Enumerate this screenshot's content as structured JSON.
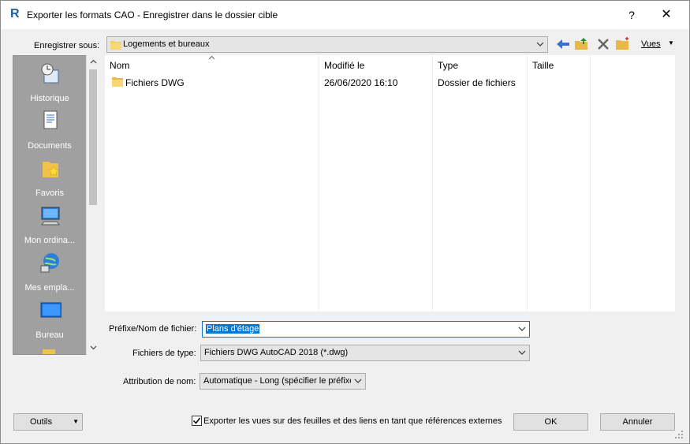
{
  "window": {
    "title": "Exporter les formats CAO - Enregistrer dans le dossier cible",
    "help_label": "?",
    "close_label": "✕"
  },
  "toolbar": {
    "save_in_label": "Enregistrer sous:",
    "current_folder": "Logements et bureaux",
    "views_label": "Vues"
  },
  "places": [
    {
      "label": "Historique",
      "icon": "history-icon"
    },
    {
      "label": "Documents",
      "icon": "documents-icon"
    },
    {
      "label": "Favoris",
      "icon": "favorites-icon"
    },
    {
      "label": "Mon ordina...",
      "icon": "computer-icon"
    },
    {
      "label": "Mes empla...",
      "icon": "network-icon"
    },
    {
      "label": "Bureau",
      "icon": "desktop-icon"
    }
  ],
  "file_list": {
    "columns": [
      "Nom",
      "Modifié le",
      "Type",
      "Taille"
    ],
    "rows": [
      {
        "name": "Fichiers DWG",
        "modified": "26/06/2020 16:10",
        "type": "Dossier de fichiers",
        "size": ""
      }
    ]
  },
  "form": {
    "filename_label": "Préfixe/Nom de fichier:",
    "filename_value": "Plans d'étage",
    "filetype_label": "Fichiers de type:",
    "filetype_value": "Fichiers DWG AutoCAD 2018  (*.dwg)",
    "naming_label": "Attribution de nom:",
    "naming_value": "Automatique - Long (spécifier le préfixe)",
    "export_checkbox_label": "Exporter les vues sur des feuilles et des liens en tant que références externes",
    "export_checkbox_checked": true
  },
  "buttons": {
    "tools": "Outils",
    "ok": "OK",
    "cancel": "Annuler"
  },
  "colors": {
    "accent": "#0078d7",
    "places_bg": "#a0a0a0",
    "folder": "#f5cd5c"
  }
}
